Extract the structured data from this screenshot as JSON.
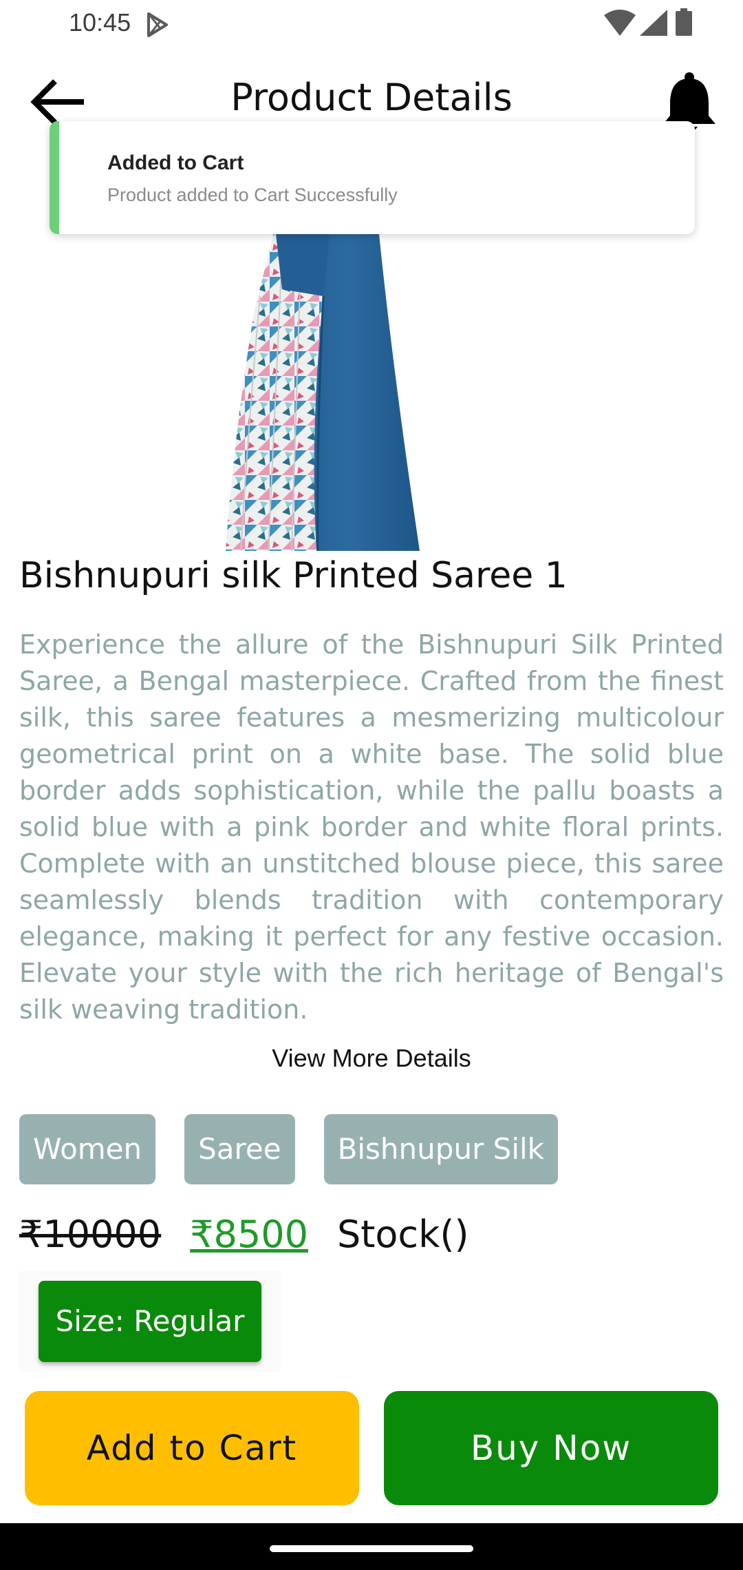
{
  "status_bar": {
    "time": "10:45"
  },
  "header": {
    "title": "Product Details"
  },
  "toast": {
    "title": "Added to Cart",
    "message": "Product added to Cart Successfully",
    "accent_color": "#6ccf7a"
  },
  "product": {
    "name": "Bishnupuri silk Printed Saree 1",
    "description": "Experience the allure of the Bishnupuri Silk Printed Saree, a Bengal masterpiece. Crafted from the finest silk, this saree features a mesmerizing multicolour geometrical print on a white base. The solid blue border adds sophistication, while the pallu boasts a solid blue with a pink border and white floral prints. Complete with an unstitched blouse piece, this saree seamlessly blends tradition with contemporary elegance, making it perfect for any festive occasion. Elevate your style with the rich heritage of Bengal's silk weaving tradition.",
    "view_more": "View More Details",
    "tags": [
      "Women",
      "Saree",
      "Bishnupur Silk"
    ],
    "mrp": "₹10000",
    "price": "₹8500",
    "stock": "Stock()",
    "size": "Size: Regular"
  },
  "actions": {
    "add_to_cart": "Add to Cart",
    "buy_now": "Buy Now"
  },
  "colors": {
    "primary_green": "#0a8a0a",
    "accent_yellow": "#ffbf00",
    "tag_bg": "#97b1b1",
    "description_text": "#8ea6a6",
    "price_green": "#1f9a2a"
  }
}
